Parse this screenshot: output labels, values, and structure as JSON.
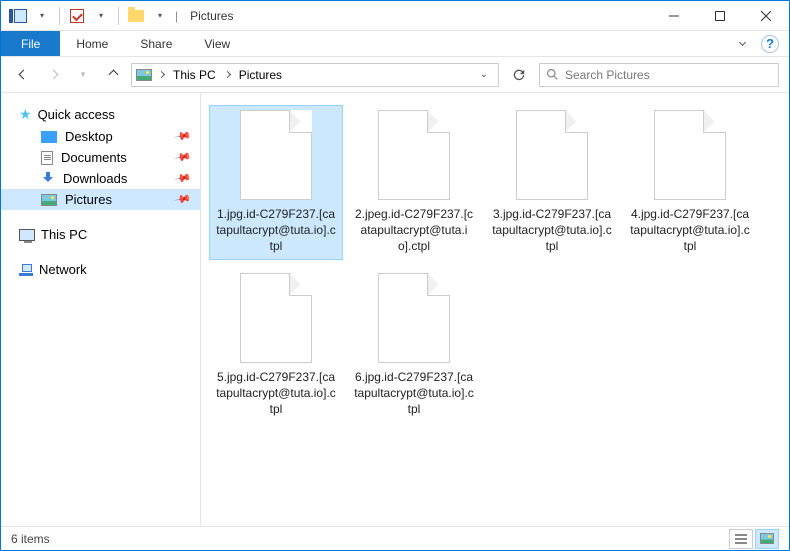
{
  "window": {
    "title": "Pictures"
  },
  "ribbon": {
    "file": "File",
    "tabs": [
      "Home",
      "Share",
      "View"
    ]
  },
  "breadcrumbs": [
    "This PC",
    "Pictures"
  ],
  "search": {
    "placeholder": "Search Pictures"
  },
  "sidebar": {
    "quickAccess": {
      "label": "Quick access"
    },
    "items": [
      {
        "label": "Desktop",
        "pinned": true
      },
      {
        "label": "Documents",
        "pinned": true
      },
      {
        "label": "Downloads",
        "pinned": true
      },
      {
        "label": "Pictures",
        "pinned": true,
        "selected": true
      }
    ],
    "thisPC": {
      "label": "This PC"
    },
    "network": {
      "label": "Network"
    }
  },
  "files": [
    {
      "name": "1.jpg.id-C279F237.[catapultacrypt@tuta.io].ctpl",
      "selected": true
    },
    {
      "name": "2.jpeg.id-C279F237.[catapultacrypt@tuta.io].ctpl",
      "selected": false
    },
    {
      "name": "3.jpg.id-C279F237.[catapultacrypt@tuta.io].ctpl",
      "selected": false
    },
    {
      "name": "4.jpg.id-C279F237.[catapultacrypt@tuta.io].ctpl",
      "selected": false
    },
    {
      "name": "5.jpg.id-C279F237.[catapultacrypt@tuta.io].ctpl",
      "selected": false
    },
    {
      "name": "6.jpg.id-C279F237.[catapultacrypt@tuta.io].ctpl",
      "selected": false
    }
  ],
  "status": {
    "count": "6 items"
  }
}
